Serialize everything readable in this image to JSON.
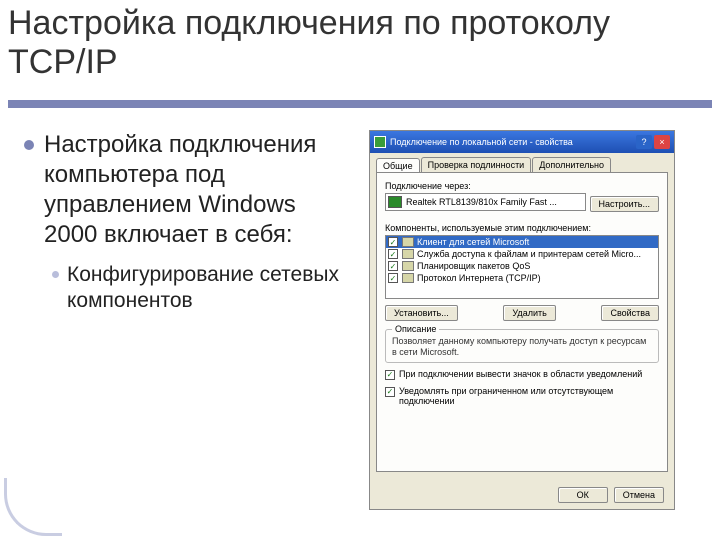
{
  "title": "Настройка подключения по протоколу TCP/IP",
  "bullets": {
    "l1": "Настройка подключения компьютера под управлением Windows 2000 включает в себя:",
    "l2": "Конфигурирование сетевых компонентов"
  },
  "dialog": {
    "titlebar": "Подключение по локальной сети - свойства",
    "close_x": "×",
    "help_q": "?",
    "tabs": {
      "general": "Общие",
      "auth": "Проверка подлинности",
      "advanced": "Дополнительно"
    },
    "connect_using": "Подключение через:",
    "adapter": "Realtek RTL8139/810x Family Fast ...",
    "configure": "Настроить...",
    "components_label": "Компоненты, используемые этим подключением:",
    "items": [
      "Клиент для сетей Microsoft",
      "Служба доступа к файлам и принтерам сетей Micro...",
      "Планировщик пакетов QoS",
      "Протокол Интернета (TCP/IP)"
    ],
    "check": "✓",
    "install": "Установить...",
    "uninstall": "Удалить",
    "properties": "Свойства",
    "desc_legend": "Описание",
    "desc_text": "Позволяет данному компьютеру получать доступ к ресурсам в сети Microsoft.",
    "opt1": "При подключении вывести значок в области уведомлений",
    "opt2": "Уведомлять при ограниченном или отсутствующем подключении",
    "ok": "ОК",
    "cancel": "Отмена"
  }
}
